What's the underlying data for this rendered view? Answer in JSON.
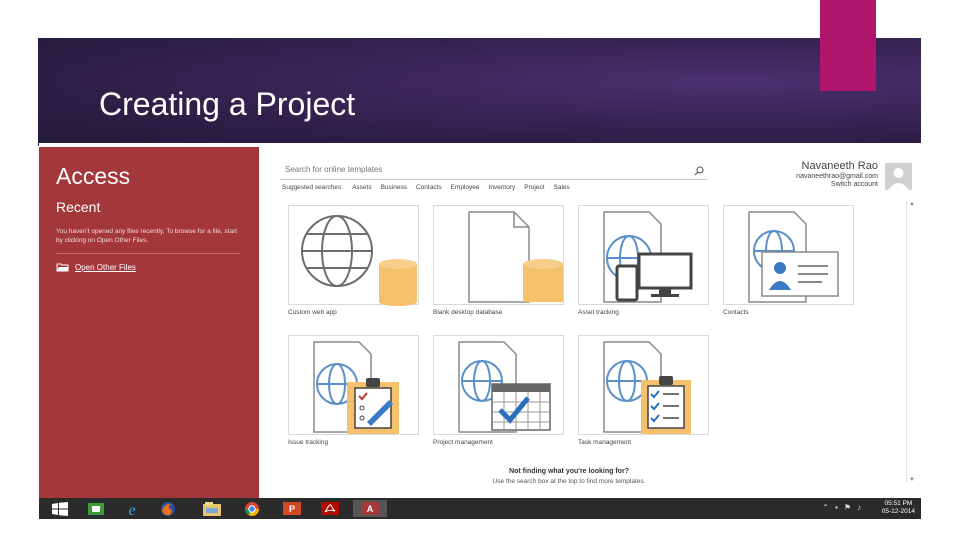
{
  "slide": {
    "title": "Creating a Project",
    "colors": {
      "banner": "#2c1f45",
      "accent": "#b0166b",
      "access_red": "#a4373a"
    }
  },
  "window": {
    "controls": [
      "?",
      "—",
      "❐",
      "✕"
    ]
  },
  "sidebar": {
    "app_name": "Access",
    "recent_heading": "Recent",
    "recent_message": "You haven't opened any files recently. To browse for a file, start by clicking on Open Other Files.",
    "open_other_files": "Open Other Files",
    "open_icon": "folder-open-icon"
  },
  "search": {
    "placeholder": "Search for online templates",
    "icon": "search-icon"
  },
  "suggested": {
    "label": "Suggested searches:",
    "items": [
      "Assets",
      "Business",
      "Contacts",
      "Employee",
      "Inventory",
      "Project",
      "Sales"
    ]
  },
  "user": {
    "name": "Navaneeth Rao",
    "email": "navaneethrao@gmail.com",
    "switch_account": "Switch account",
    "avatar_icon": "person-avatar-icon"
  },
  "templates": [
    {
      "label": "Custom web app",
      "icon": "globe-database-icon"
    },
    {
      "label": "Blank desktop database",
      "icon": "page-database-icon"
    },
    {
      "label": "Asset tracking",
      "icon": "globe-devices-icon"
    },
    {
      "label": "Contacts",
      "icon": "globe-contact-card-icon"
    },
    {
      "label": "Issue tracking",
      "icon": "globe-clipboard-pencil-icon"
    },
    {
      "label": "Project management",
      "icon": "globe-calendar-check-icon"
    },
    {
      "label": "Task management",
      "icon": "globe-clipboard-checklist-icon"
    }
  ],
  "footer": {
    "question": "Not finding what you're looking for?",
    "hint": "Use the search box at the top to find more templates."
  },
  "taskbar": {
    "apps": [
      "start-icon",
      "store-icon",
      "internet-explorer-icon",
      "firefox-icon",
      "file-explorer-icon",
      "chrome-icon",
      "powerpoint-icon",
      "acrobat-icon",
      "access-icon"
    ],
    "time": "05:51 PM",
    "date": "05-12-2014"
  }
}
